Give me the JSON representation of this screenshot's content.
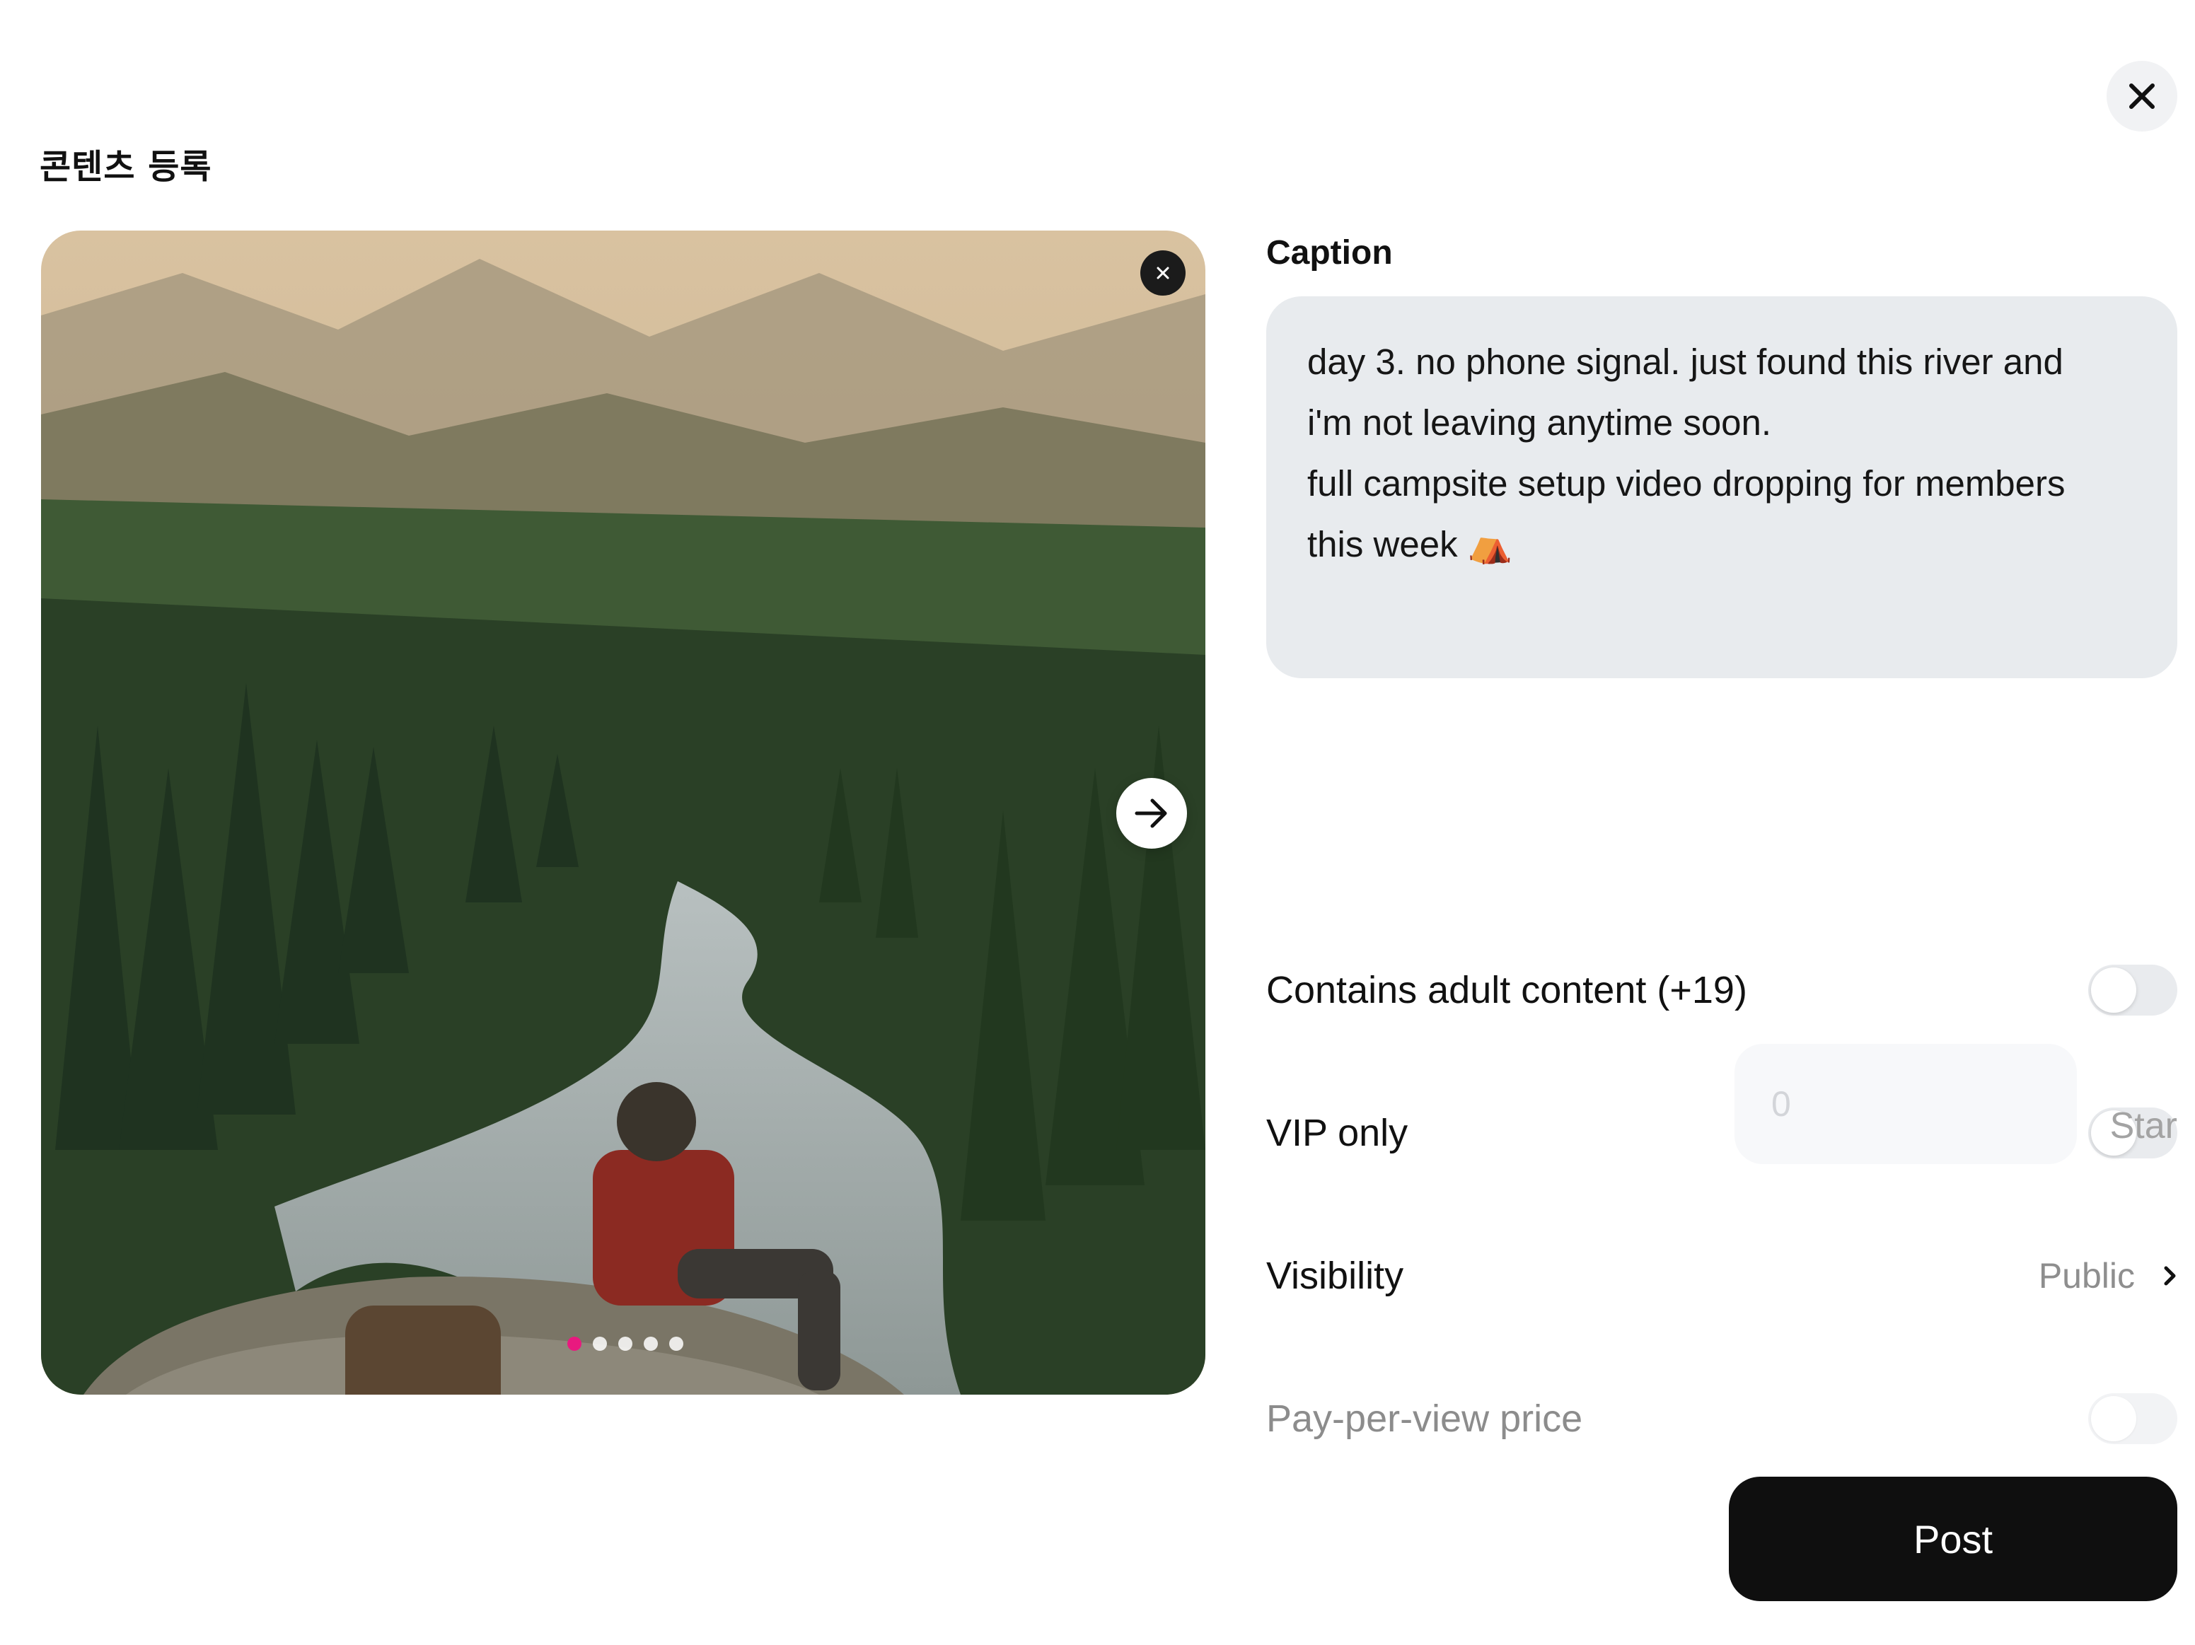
{
  "header": {
    "title": "콘텐츠 등록"
  },
  "media": {
    "current_index": 1,
    "total": 5
  },
  "caption": {
    "label": "Caption",
    "text": "day 3. no phone signal. just found this river and\ni'm not leaving anytime soon.\nfull campsite setup video dropping for members\nthis week ⛺"
  },
  "settings": {
    "adult": {
      "label": "Contains adult content (+19)",
      "enabled": false
    },
    "vip": {
      "label": "VIP only",
      "enabled": false
    },
    "visibility": {
      "label": "Visibility",
      "value": "Public"
    },
    "ppv": {
      "label": "Pay-per-view price",
      "enabled": false,
      "placeholder": "0",
      "unit": "Star"
    }
  },
  "actions": {
    "post_label": "Post"
  },
  "colors": {
    "accent_dot": "#e8197f",
    "caption_bg": "#e8ebee",
    "post_bg": "#0f0f0f"
  }
}
